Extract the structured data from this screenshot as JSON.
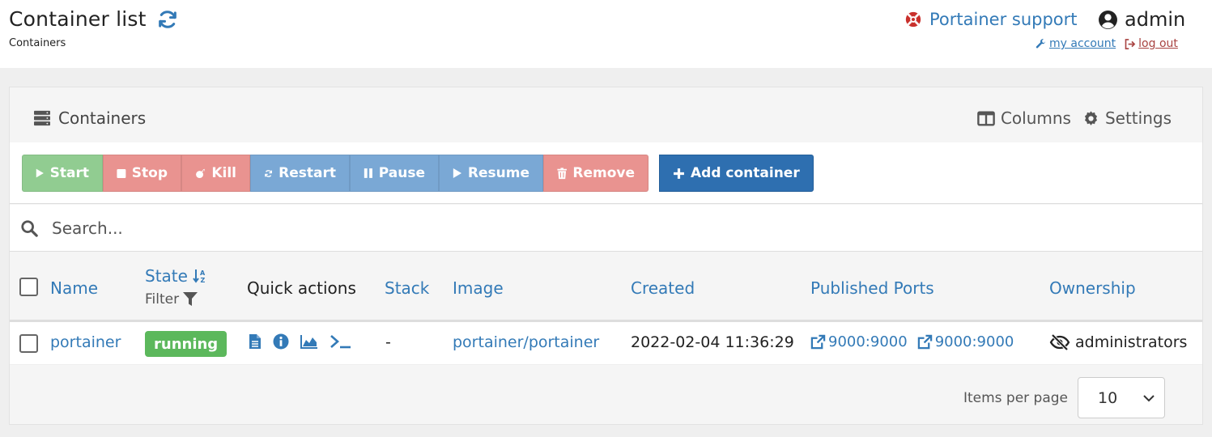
{
  "header": {
    "title": "Container list",
    "breadcrumb": "Containers",
    "support_label": "Portainer support",
    "username": "admin",
    "my_account_label": "my account",
    "logout_label": "log out"
  },
  "panel": {
    "title": "Containers",
    "columns_label": "Columns",
    "settings_label": "Settings"
  },
  "actions": {
    "start": "Start",
    "stop": "Stop",
    "kill": "Kill",
    "restart": "Restart",
    "pause": "Pause",
    "resume": "Resume",
    "remove": "Remove",
    "add": "Add container"
  },
  "search": {
    "placeholder": "Search..."
  },
  "table": {
    "headers": {
      "name": "Name",
      "state": "State",
      "state_filter": "Filter",
      "quick_actions": "Quick actions",
      "stack": "Stack",
      "image": "Image",
      "created": "Created",
      "ports": "Published Ports",
      "ownership": "Ownership"
    },
    "rows": [
      {
        "name": "portainer",
        "state": "running",
        "stack": "-",
        "image": "portainer/portainer",
        "created": "2022-02-04 11:36:29",
        "ports": [
          "9000:9000",
          "9000:9000"
        ],
        "ownership": "administrators"
      }
    ]
  },
  "pagination": {
    "items_per_page_label": "Items per page",
    "items_per_page_value": "10"
  },
  "colors": {
    "link": "#337ab7",
    "start": "#91cc91",
    "danger": "#e99390",
    "info": "#7aa8d5",
    "primary": "#2e6fb0",
    "running": "#5cb85c"
  }
}
